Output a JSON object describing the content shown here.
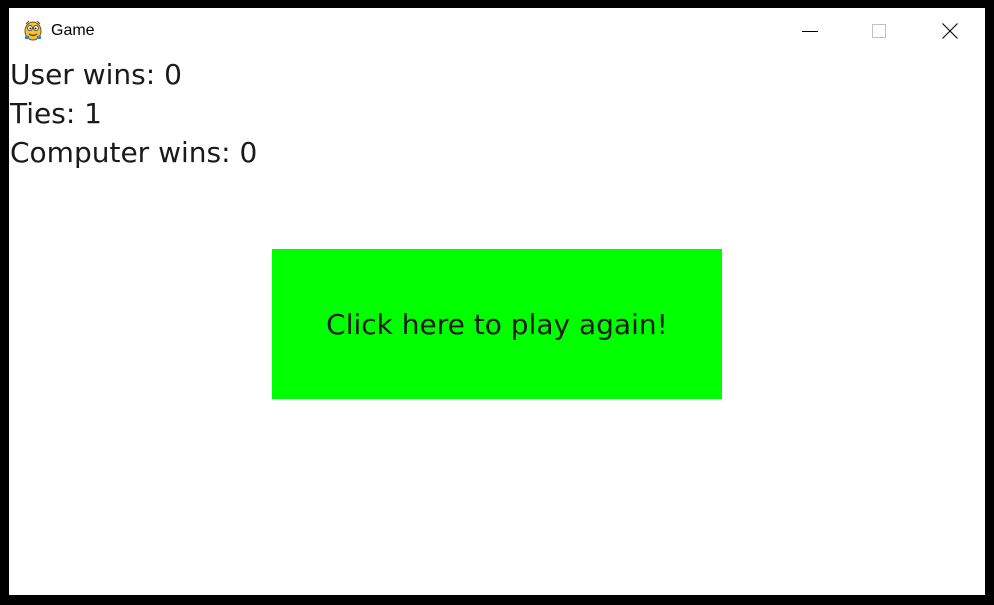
{
  "window": {
    "title": "Game",
    "icon": "pygame-snake-icon",
    "controls": {
      "minimize": "minimize-icon",
      "maximize": "maximize-icon",
      "close": "close-icon"
    }
  },
  "scoreboard": {
    "user_wins": "User wins: 0",
    "ties": "Ties: 1",
    "computer_wins": "Computer wins: 0"
  },
  "play_again": {
    "label": "Click here to play again!",
    "color": "#00ff00"
  },
  "colors": {
    "background": "#ffffff",
    "frame": "#000000",
    "text": "#1a1a1a"
  }
}
